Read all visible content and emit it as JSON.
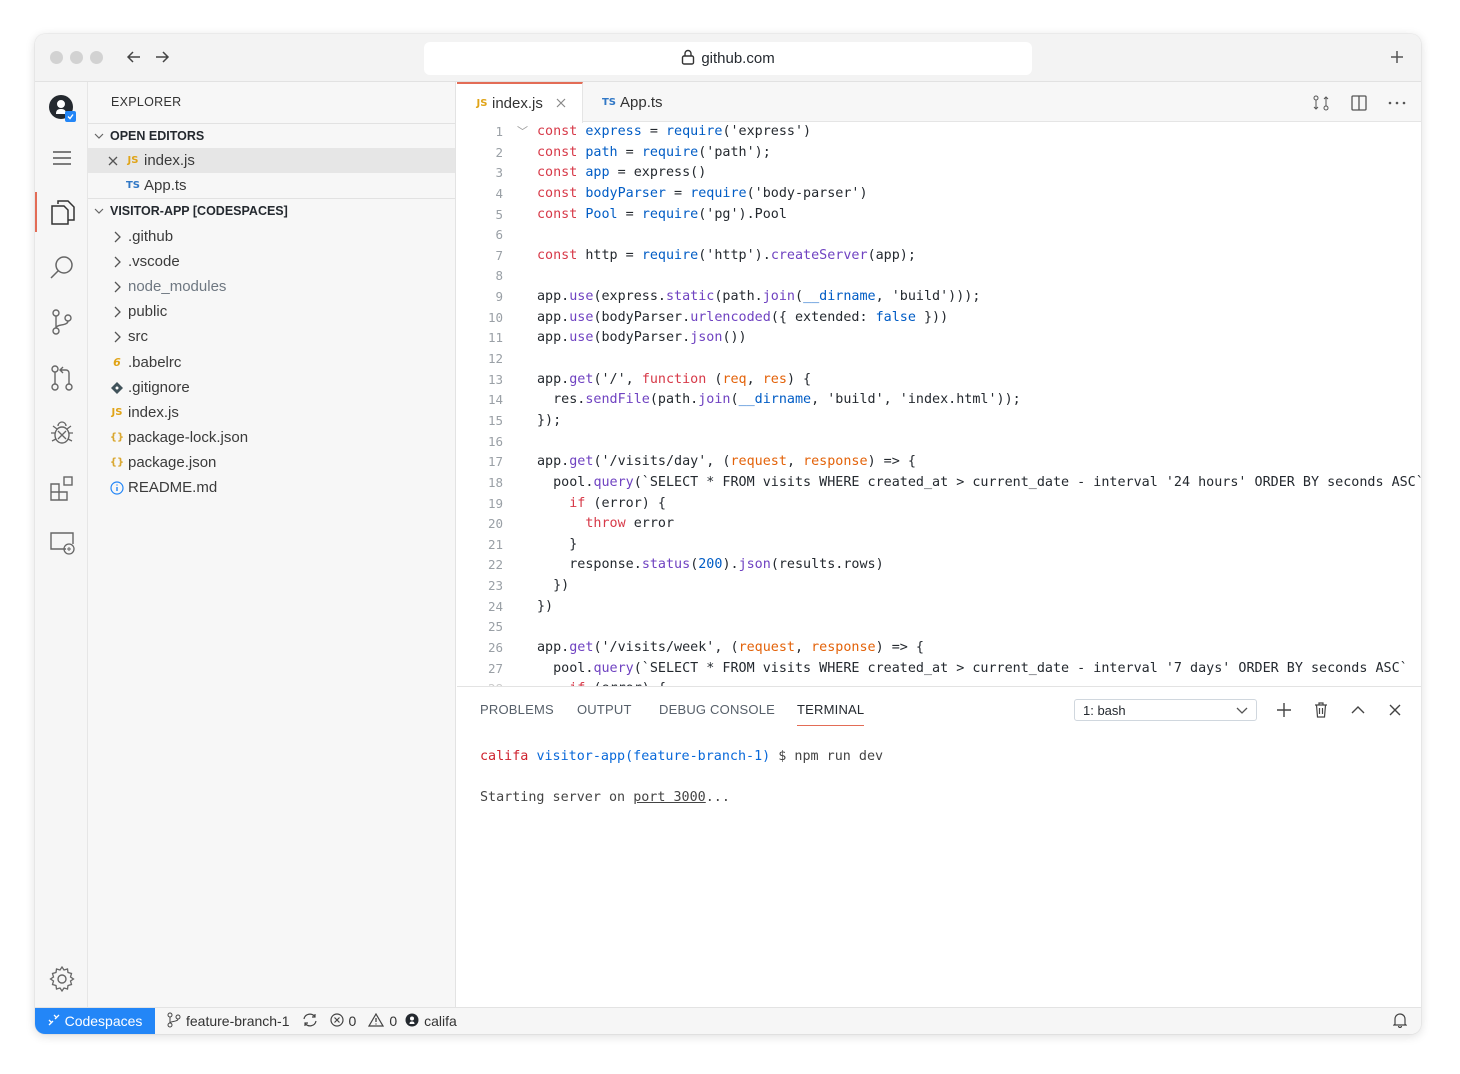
{
  "browser": {
    "url": "github.com"
  },
  "sidebar": {
    "title": "EXPLORER",
    "open_editors_title": "OPEN EDITORS",
    "open_editors": [
      {
        "icon": "JS",
        "name": "index.js"
      },
      {
        "icon": "TS",
        "name": "App.ts"
      }
    ],
    "project_title": "VISITOR-APP [CODESPACES]",
    "folders": [
      ".github",
      ".vscode",
      "node_modules",
      "public",
      "src"
    ],
    "files": [
      {
        "icon": "babel-icon",
        "name": ".babelrc"
      },
      {
        "icon": "git-icon",
        "name": ".gitignore"
      },
      {
        "icon": "JS",
        "name": "index.js"
      },
      {
        "icon": "{}",
        "name": "package-lock.json"
      },
      {
        "icon": "{}",
        "name": "package.json"
      },
      {
        "icon": "info-icon",
        "name": "README.md"
      }
    ]
  },
  "tabs": [
    {
      "icon": "JS",
      "label": "index.js"
    },
    {
      "icon": "TS",
      "label": "App.ts"
    }
  ],
  "code_lines": [
    "1",
    "2",
    "3",
    "4",
    "5",
    "6",
    "7",
    "8",
    "9",
    "10",
    "11",
    "12",
    "13",
    "14",
    "15",
    "16",
    "17",
    "18",
    "19",
    "20",
    "21",
    "22",
    "23",
    "24",
    "25",
    "26",
    "27"
  ],
  "panel": {
    "tabs": [
      "PROBLEMS",
      "OUTPUT",
      "DEBUG CONSOLE",
      "TERMINAL"
    ],
    "terminal_select": "1: bash",
    "prompt_user": "califa",
    "prompt_dir": "visitor-app(feature-branch-1)",
    "prompt_cmd": "$ npm run dev",
    "output_prefix": "Starting server on ",
    "output_port": "port 3000",
    "output_suffix": "..."
  },
  "status": {
    "remote": "Codespaces",
    "branch": "feature-branch-1",
    "errors": "0",
    "warnings": "0",
    "user": "califa"
  },
  "colors": {
    "accent": "#e36c56",
    "remote": "#2386f7"
  }
}
